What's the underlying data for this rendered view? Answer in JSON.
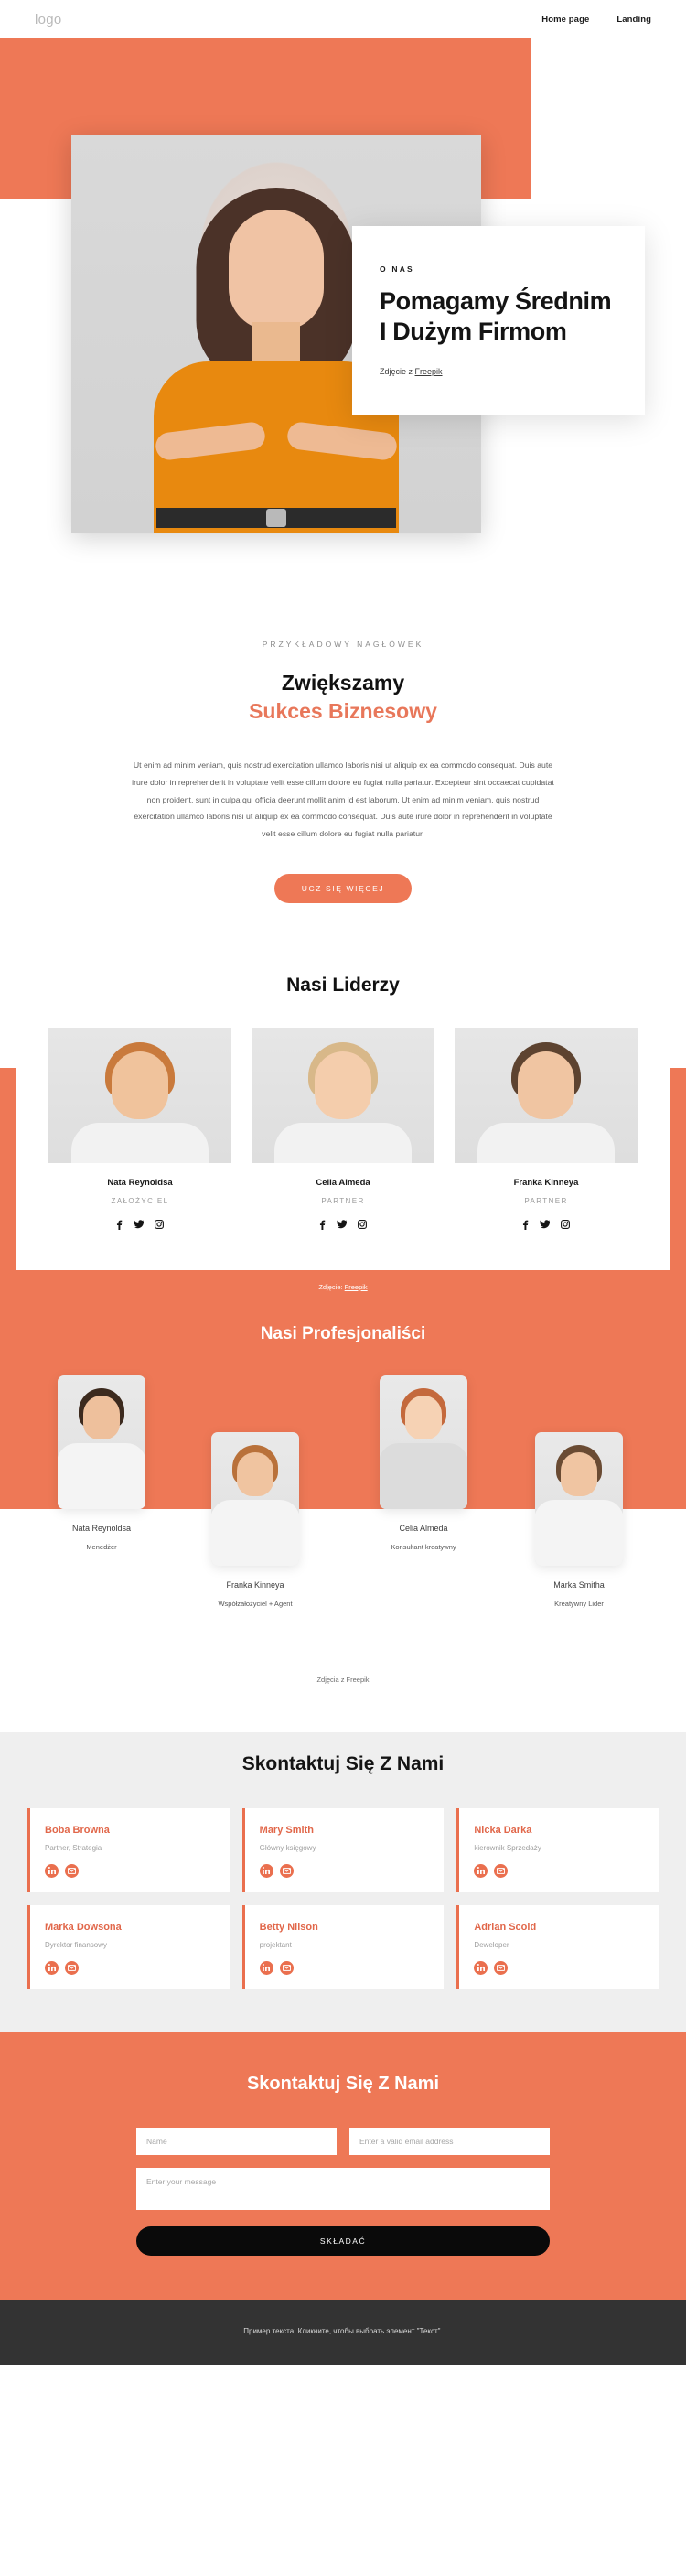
{
  "header": {
    "logo": "logo",
    "nav": [
      {
        "label": "Home page"
      },
      {
        "label": "Landing"
      }
    ]
  },
  "hero": {
    "eyebrow": "O NAS",
    "title": "Pomagamy Średnim I Dużym Firmom",
    "credit_prefix": "Zdjęcie z ",
    "credit_link": "Freepik"
  },
  "intro": {
    "kicker": "PRZYKŁADOWY NAGŁÓWEK",
    "title_line1": "Zwiększamy",
    "title_line2": "Sukces Biznesowy",
    "paragraph": "Ut enim ad minim veniam, quis nostrud exercitation ullamco laboris nisi ut aliquip ex ea commodo consequat. Duis aute irure dolor in reprehenderit in voluptate velit esse cillum dolore eu fugiat nulla pariatur. Excepteur sint occaecat cupidatat non proident, sunt in culpa qui officia deerunt mollit anim id est laborum. Ut enim ad minim veniam, quis nostrud exercitation ullamco laboris nisi ut aliquip ex ea commodo consequat. Duis aute irure dolor in reprehenderit in voluptate velit esse cillum dolore eu fugiat nulla pariatur.",
    "button": "UCZ SIĘ WIĘCEJ"
  },
  "leaders": {
    "title": "Nasi Liderzy",
    "credit_prefix": "Zdjęcie: ",
    "credit_link": "Freepik",
    "items": [
      {
        "name": "Nata Reynoldsa",
        "role": "ZAŁOŻYCIEL"
      },
      {
        "name": "Celia Almeda",
        "role": "PARTNER"
      },
      {
        "name": "Franka Kinneya",
        "role": "PARTNER"
      }
    ],
    "social": [
      "facebook-icon",
      "twitter-icon",
      "instagram-icon"
    ]
  },
  "professionals": {
    "title": "Nasi Profesjonaliści",
    "credit": "Zdjęcia z Freepik",
    "items": [
      {
        "name": "Nata Reynoldsa",
        "role": "Menedżer"
      },
      {
        "name": "Franka Kinneya",
        "role": "Współzałożyciel + Agent"
      },
      {
        "name": "Celia Almeda",
        "role": "Konsultant kreatywny"
      },
      {
        "name": "Marka Smitha",
        "role": "Kreatywny Lider"
      }
    ]
  },
  "contacts": {
    "title": "Skontaktuj Się Z Nami",
    "cards": [
      {
        "name": "Boba Browna",
        "role": "Partner, Strategia"
      },
      {
        "name": "Mary Smith",
        "role": "Główny księgowy"
      },
      {
        "name": "Nicka Darka",
        "role": "kierownik Sprzedaży"
      },
      {
        "name": "Marka Dowsona",
        "role": "Dyrektor finansowy"
      },
      {
        "name": "Betty Nilson",
        "role": "projektant"
      },
      {
        "name": "Adrian Scold",
        "role": "Deweloper"
      }
    ],
    "card_icons": [
      "linkedin-icon",
      "email-icon"
    ]
  },
  "form": {
    "title": "Skontaktuj Się Z Nami",
    "name_placeholder": "Name",
    "email_placeholder": "Enter a valid email address",
    "message_placeholder": "Enter your message",
    "submit": "SKŁADAĆ",
    "name_value": "",
    "email_value": "",
    "message_value": ""
  },
  "footer": {
    "text": "Пример текста. Кликните, чтобы выбрать элемент \"Текст\"."
  },
  "colors": {
    "accent": "#ee7856",
    "accent_text": "#e1674a",
    "dark": "#0a0a0a",
    "footer_bg": "#333333",
    "light_bg": "#efefef"
  }
}
